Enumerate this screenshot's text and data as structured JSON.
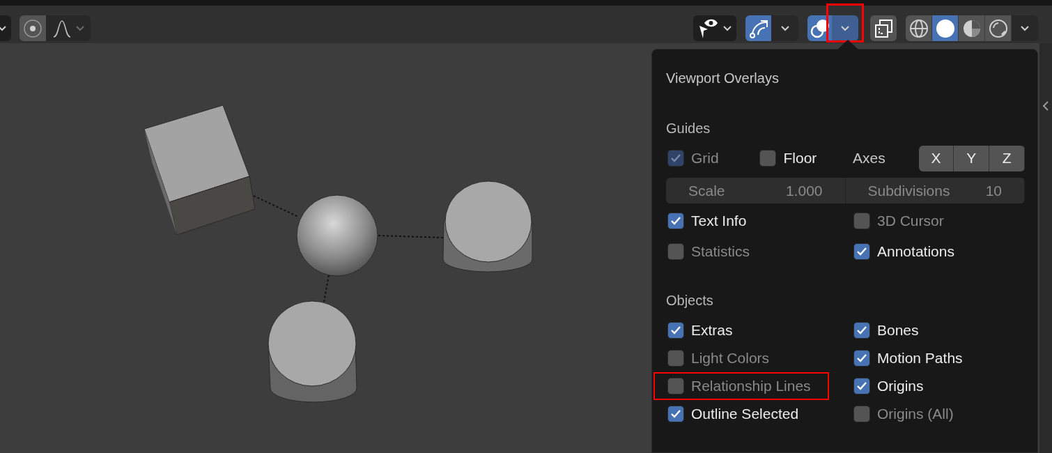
{
  "toolbar": {
    "proportional_editing": {
      "on": false
    },
    "gizmos": {
      "on": true
    },
    "overlays": {
      "on": true,
      "highlighted": true
    },
    "xray": {
      "on": false
    },
    "shading_modes": [
      {
        "kind": "wireframe",
        "selected": false
      },
      {
        "kind": "solid",
        "selected": true
      },
      {
        "kind": "material",
        "selected": false
      },
      {
        "kind": "rendered",
        "selected": false
      }
    ]
  },
  "overlays_popup": {
    "title": "Viewport Overlays",
    "guides": {
      "title": "Guides",
      "grid": {
        "label": "Grid",
        "checked": true,
        "disabled": true
      },
      "floor": {
        "label": "Floor",
        "checked": false,
        "disabled": false
      },
      "axes": {
        "label": "Axes",
        "toggles": [
          {
            "label": "X",
            "on": false
          },
          {
            "label": "Y",
            "on": false
          },
          {
            "label": "Z",
            "on": false
          }
        ]
      },
      "fields": [
        {
          "label": "Scale",
          "value": "1.000"
        },
        {
          "label": "Subdivisions",
          "value": "10"
        }
      ],
      "checkboxes": [
        {
          "label": "Text Info",
          "checked": true,
          "disabled": false
        },
        {
          "label": "3D Cursor",
          "checked": false,
          "disabled": true
        },
        {
          "label": "Statistics",
          "checked": false,
          "disabled": true
        },
        {
          "label": "Annotations",
          "checked": true,
          "disabled": false
        }
      ]
    },
    "objects": {
      "title": "Objects",
      "checkboxes": [
        {
          "label": "Extras",
          "checked": true,
          "disabled": false,
          "highlighted": false
        },
        {
          "label": "Bones",
          "checked": true,
          "disabled": false,
          "highlighted": false
        },
        {
          "label": "Light Colors",
          "checked": false,
          "disabled": true,
          "highlighted": false
        },
        {
          "label": "Motion Paths",
          "checked": true,
          "disabled": false,
          "highlighted": false
        },
        {
          "label": "Relationship Lines",
          "checked": false,
          "disabled": true,
          "highlighted": true
        },
        {
          "label": "Origins",
          "checked": true,
          "disabled": false,
          "highlighted": false
        },
        {
          "label": "Outline Selected",
          "checked": true,
          "disabled": false,
          "highlighted": false
        },
        {
          "label": "Origins (All)",
          "checked": false,
          "disabled": true,
          "highlighted": false
        }
      ]
    }
  }
}
